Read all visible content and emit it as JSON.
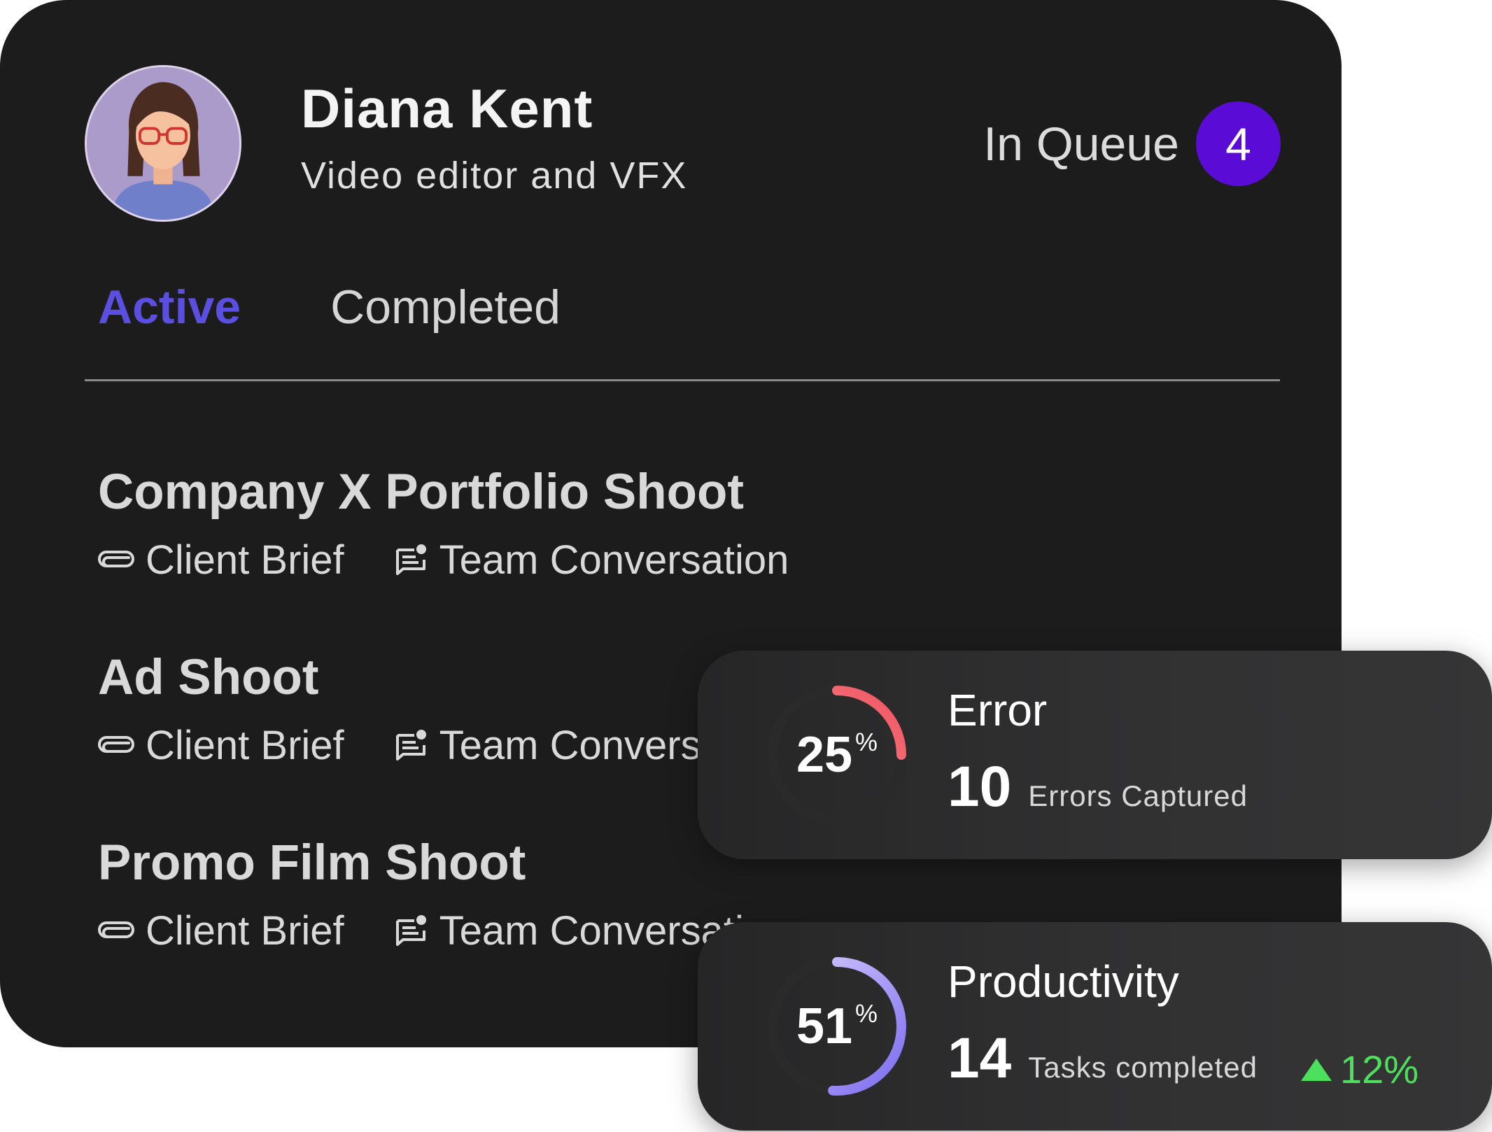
{
  "profile": {
    "name": "Diana Kent",
    "role": "Video editor and VFX",
    "avatar_icon": "woman-with-glasses-avatar"
  },
  "queue": {
    "label": "In Queue",
    "count": "4",
    "badge_color": "#5b0bd6"
  },
  "tabs": [
    {
      "label": "Active",
      "active": true
    },
    {
      "label": "Completed",
      "active": false
    }
  ],
  "colors": {
    "card_background": "#1c1c1d",
    "active_tab": "#5a4fe0",
    "trend_up": "#4de05c"
  },
  "projects": [
    {
      "title": "Company X Portfolio Shoot",
      "links": [
        {
          "label": "Client Brief",
          "icon": "paperclip-icon"
        },
        {
          "label": "Team Conversation",
          "icon": "chat-notification-icon"
        }
      ]
    },
    {
      "title": "Ad Shoot",
      "links": [
        {
          "label": "Client Brief",
          "icon": "paperclip-icon"
        },
        {
          "label": "Team Conversation",
          "icon": "chat-notification-icon"
        }
      ]
    },
    {
      "title": "Promo Film Shoot",
      "links": [
        {
          "label": "Client Brief",
          "icon": "paperclip-icon"
        },
        {
          "label": "Team Conversation",
          "icon": "chat-notification-icon"
        }
      ]
    }
  ],
  "stats": {
    "error": {
      "title": "Error",
      "percent": "25",
      "percent_unit": "%",
      "progress": 0.25,
      "count": "10",
      "caption": "Errors Captured",
      "ring_colors": [
        "#ff9c9c",
        "#ef5461"
      ]
    },
    "productivity": {
      "title": "Productivity",
      "percent": "51",
      "percent_unit": "%",
      "progress": 0.51,
      "count": "14",
      "caption": "Tasks completed",
      "trend": "12%",
      "trend_direction": "up",
      "ring_colors": [
        "#7d6cf0",
        "#d9d0ff"
      ]
    }
  }
}
